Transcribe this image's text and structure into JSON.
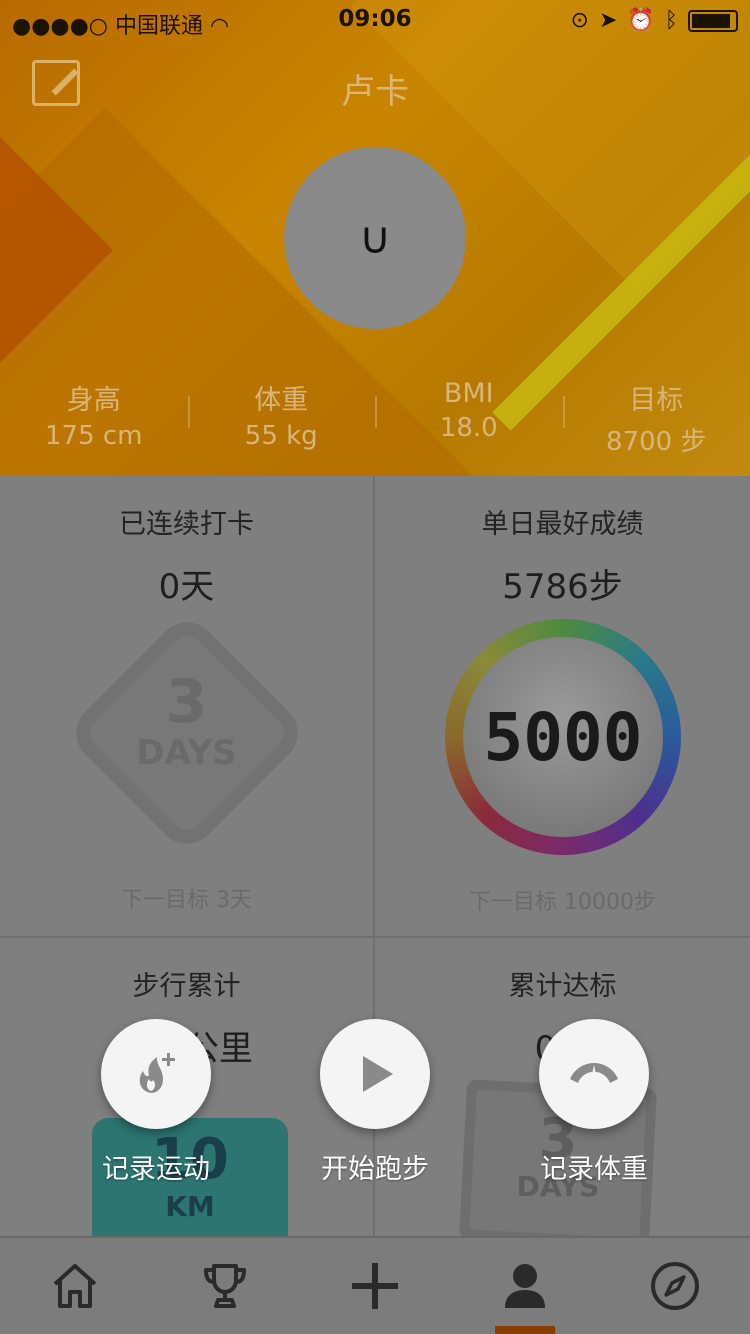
{
  "status_bar": {
    "signal": "●●●●○",
    "carrier": "中国联通",
    "time": "09:06"
  },
  "header": {
    "title": "卢卡",
    "avatar_text": "∪",
    "stats": [
      {
        "label": "身高",
        "value": "175 cm"
      },
      {
        "label": "体重",
        "value": "55 kg"
      },
      {
        "label": "BMI",
        "value": "18.0"
      },
      {
        "label": "目标",
        "value": "8700 步"
      }
    ]
  },
  "cards": {
    "streak": {
      "title": "已连续打卡",
      "value": "0天",
      "badge_num": "3",
      "badge_unit": "DAYS",
      "next": "下一目标  3天"
    },
    "best_day": {
      "title": "单日最好成绩",
      "value": "5786步",
      "badge_num": "5000",
      "next": "下一目标 10000步"
    },
    "walk_total": {
      "title": "步行累计",
      "value": "1.0 公里",
      "badge_num": "10",
      "badge_unit": "KM"
    },
    "goal_total": {
      "title": "累计达标",
      "value": "0天",
      "badge_num": "3",
      "badge_unit": "DAYS"
    }
  },
  "actions": [
    {
      "label": "记录运动",
      "icon": "flame-plus-icon"
    },
    {
      "label": "开始跑步",
      "icon": "play-icon"
    },
    {
      "label": "记录体重",
      "icon": "scale-icon"
    }
  ],
  "tabbar": {
    "items": [
      "home-icon",
      "trophy-icon",
      "plus-icon",
      "person-icon",
      "compass-icon"
    ],
    "active": "person-icon"
  },
  "colors": {
    "accent": "#8a3d00",
    "header_text": "#dcb67a",
    "overlay_gray": "#7f7f7f"
  }
}
